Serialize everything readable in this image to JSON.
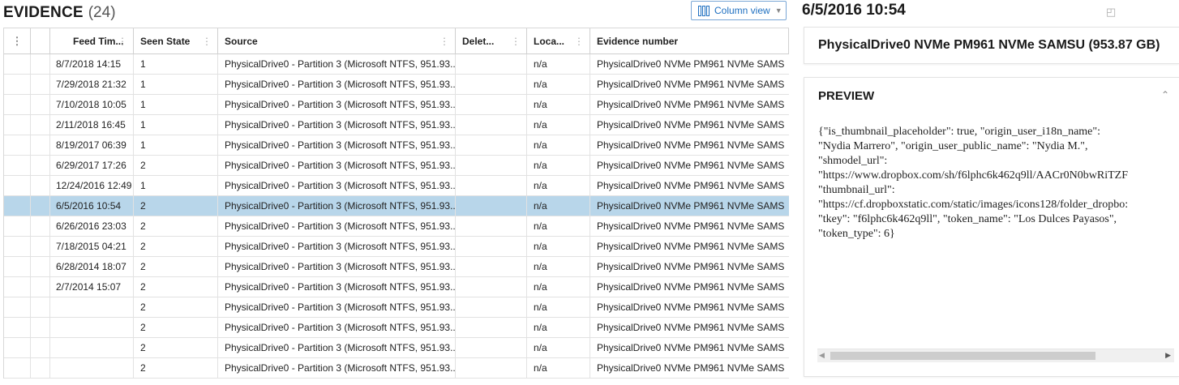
{
  "evidence_panel": {
    "title": "EVIDENCE",
    "count": "(24)",
    "column_view_label": "Column view"
  },
  "columns": [
    "Feed Tim...",
    "Seen State",
    "Source",
    "Delet...",
    "Loca...",
    "Evidence number"
  ],
  "rows": [
    {
      "feed_time": "8/7/2018 14:15",
      "seen": "1",
      "source": "PhysicalDrive0 - Partition 3 (Microsoft NTFS, 951.93...",
      "deleted": "",
      "location": "n/a",
      "evidence": "PhysicalDrive0 NVMe PM961 NVMe SAMS"
    },
    {
      "feed_time": "7/29/2018 21:32",
      "seen": "1",
      "source": "PhysicalDrive0 - Partition 3 (Microsoft NTFS, 951.93...",
      "deleted": "",
      "location": "n/a",
      "evidence": "PhysicalDrive0 NVMe PM961 NVMe SAMS"
    },
    {
      "feed_time": "7/10/2018 10:05",
      "seen": "1",
      "source": "PhysicalDrive0 - Partition 3 (Microsoft NTFS, 951.93...",
      "deleted": "",
      "location": "n/a",
      "evidence": "PhysicalDrive0 NVMe PM961 NVMe SAMS"
    },
    {
      "feed_time": "2/11/2018 16:45",
      "seen": "1",
      "source": "PhysicalDrive0 - Partition 3 (Microsoft NTFS, 951.93...",
      "deleted": "",
      "location": "n/a",
      "evidence": "PhysicalDrive0 NVMe PM961 NVMe SAMS"
    },
    {
      "feed_time": "8/19/2017 06:39",
      "seen": "1",
      "source": "PhysicalDrive0 - Partition 3 (Microsoft NTFS, 951.93...",
      "deleted": "",
      "location": "n/a",
      "evidence": "PhysicalDrive0 NVMe PM961 NVMe SAMS"
    },
    {
      "feed_time": "6/29/2017 17:26",
      "seen": "2",
      "source": "PhysicalDrive0 - Partition 3 (Microsoft NTFS, 951.93...",
      "deleted": "",
      "location": "n/a",
      "evidence": "PhysicalDrive0 NVMe PM961 NVMe SAMS"
    },
    {
      "feed_time": "12/24/2016 12:49",
      "seen": "1",
      "source": "PhysicalDrive0 - Partition 3 (Microsoft NTFS, 951.93...",
      "deleted": "",
      "location": "n/a",
      "evidence": "PhysicalDrive0 NVMe PM961 NVMe SAMS"
    },
    {
      "feed_time": "6/5/2016 10:54",
      "seen": "2",
      "source": "PhysicalDrive0 - Partition 3 (Microsoft NTFS, 951.93...",
      "deleted": "",
      "location": "n/a",
      "evidence": "PhysicalDrive0 NVMe PM961 NVMe SAMS",
      "selected": true
    },
    {
      "feed_time": "6/26/2016 23:03",
      "seen": "2",
      "source": "PhysicalDrive0 - Partition 3 (Microsoft NTFS, 951.93...",
      "deleted": "",
      "location": "n/a",
      "evidence": "PhysicalDrive0 NVMe PM961 NVMe SAMS"
    },
    {
      "feed_time": "7/18/2015 04:21",
      "seen": "2",
      "source": "PhysicalDrive0 - Partition 3 (Microsoft NTFS, 951.93...",
      "deleted": "",
      "location": "n/a",
      "evidence": "PhysicalDrive0 NVMe PM961 NVMe SAMS"
    },
    {
      "feed_time": "6/28/2014 18:07",
      "seen": "2",
      "source": "PhysicalDrive0 - Partition 3 (Microsoft NTFS, 951.93...",
      "deleted": "",
      "location": "n/a",
      "evidence": "PhysicalDrive0 NVMe PM961 NVMe SAMS"
    },
    {
      "feed_time": "2/7/2014 15:07",
      "seen": "2",
      "source": "PhysicalDrive0 - Partition 3 (Microsoft NTFS, 951.93...",
      "deleted": "",
      "location": "n/a",
      "evidence": "PhysicalDrive0 NVMe PM961 NVMe SAMS"
    },
    {
      "feed_time": "",
      "seen": "2",
      "source": "PhysicalDrive0 - Partition 3 (Microsoft NTFS, 951.93...",
      "deleted": "",
      "location": "n/a",
      "evidence": "PhysicalDrive0 NVMe PM961 NVMe SAMS"
    },
    {
      "feed_time": "",
      "seen": "2",
      "source": "PhysicalDrive0 - Partition 3 (Microsoft NTFS, 951.93...",
      "deleted": "",
      "location": "n/a",
      "evidence": "PhysicalDrive0 NVMe PM961 NVMe SAMS"
    },
    {
      "feed_time": "",
      "seen": "2",
      "source": "PhysicalDrive0 - Partition 3 (Microsoft NTFS, 951.93...",
      "deleted": "",
      "location": "n/a",
      "evidence": "PhysicalDrive0 NVMe PM961 NVMe SAMS"
    },
    {
      "feed_time": "",
      "seen": "2",
      "source": "PhysicalDrive0 - Partition 3 (Microsoft NTFS, 951.93...",
      "deleted": "",
      "location": "n/a",
      "evidence": "PhysicalDrive0 NVMe PM961 NVMe SAMS"
    }
  ],
  "detail": {
    "title": "6/5/2016 10:54",
    "evidence_full": "PhysicalDrive0 NVMe PM961 NVMe SAMSU (953.87 GB)",
    "preview_title": "PREVIEW",
    "preview_text": "{\"is_thumbnail_placeholder\": true, \"origin_user_i18n_name\":\n\"Nydia Marrero\", \"origin_user_public_name\": \"Nydia M.\",\n\"shmodel_url\":\n\"https://www.dropbox.com/sh/f6lphc6k462q9ll/AACr0N0bwRiTZF\n\"thumbnail_url\":\n\"https://cf.dropboxstatic.com/static/images/icons128/folder_dropbo:\n\"tkey\": \"f6lphc6k462q9ll\", \"token_name\": \"Los Dulces Payasos\",\n\"token_type\": 6}"
  },
  "colors": {
    "selected_row": "#b8d6ea",
    "accent": "#1e6fc0"
  },
  "icons": [
    "column-view-icon",
    "chevron-down-icon",
    "pin-icon",
    "collapse-up-icon",
    "scroll-left-icon",
    "scroll-right-icon",
    "column-menu-icon"
  ]
}
